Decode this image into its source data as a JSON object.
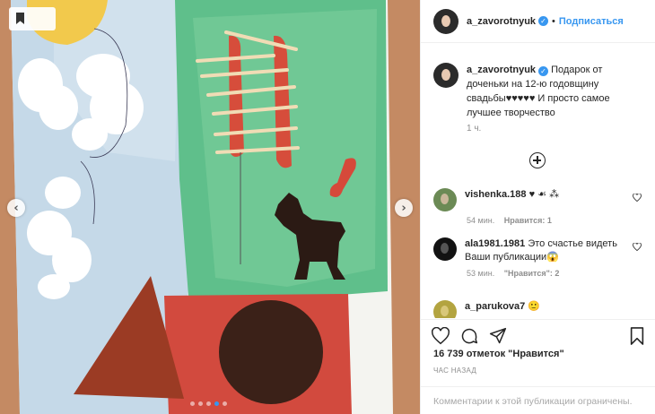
{
  "post": {
    "username": "a_zavorotnyuk",
    "follow_label": "Подписаться",
    "separator": "•",
    "caption_text": "Подарок от доченьки на 12-ю годовщину свадьбы♥♥♥♥♥ И просто самое лучшее творчество",
    "caption_time": "1 ч."
  },
  "comments": [
    {
      "username": "vishenka.188",
      "text": "♥ ☙ ⁂",
      "time": "54 мин.",
      "likes": "Нравится: 1",
      "reply": ""
    },
    {
      "username": "ala1981.1981",
      "text": "Это счастье видеть Ваши публикации😱",
      "time": "53 мин.",
      "likes": "\"Нравится\": 2",
      "reply": ""
    },
    {
      "username": "a_parukova7",
      "text": "🙂",
      "time": "",
      "likes": "",
      "reply": ""
    }
  ],
  "actions": {
    "likes_count": "16 739 отметок \"Нравится\"",
    "date_label": "ЧАС НАЗАД",
    "comments_disabled": "Комментарии к этой публикации ограничены."
  },
  "media": {
    "carousel_total": 5,
    "carousel_active": 3
  },
  "colors": {
    "accent": "#3897f0",
    "text": "#262626",
    "muted": "#8e8e8e"
  },
  "icons": [
    "bookmark-icon",
    "chevron-left-icon",
    "chevron-right-icon",
    "verified-badge-icon",
    "add-comment-icon",
    "heart-icon",
    "comment-icon",
    "share-icon",
    "save-icon"
  ]
}
